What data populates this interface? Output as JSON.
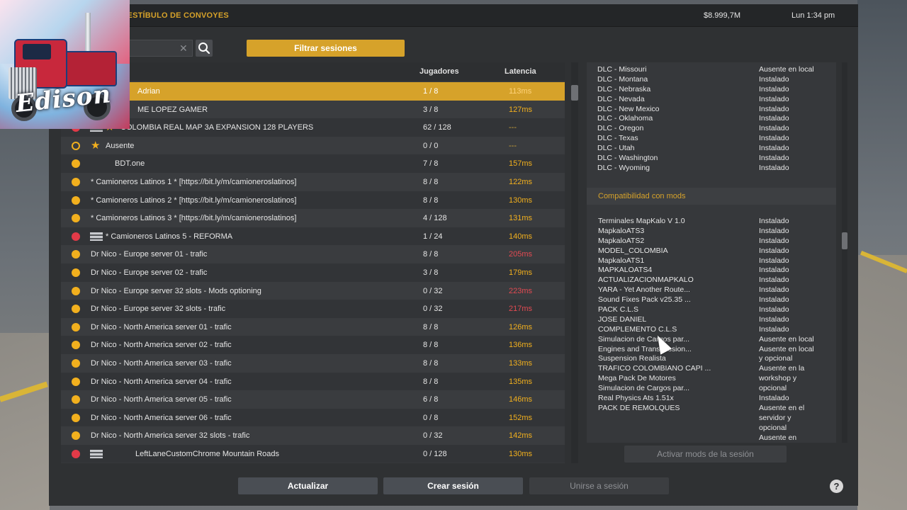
{
  "topbar": {
    "title": "VESTÍBULO DE CONVOYES",
    "money": "$8.999,7M",
    "time": "Lun 1:34 pm"
  },
  "logo": {
    "signature": "Edison"
  },
  "search": {
    "value": "",
    "placeholder": ""
  },
  "filter_button": "Filtrar sesiones",
  "list_header": {
    "players": "Jugadores",
    "latency": "Latencia"
  },
  "servers": [
    {
      "name": "Adrian",
      "players": "1 / 8",
      "latency": "113ms"
    },
    {
      "name": "ME LOPEZ GAMER",
      "players": "3 / 8",
      "latency": "127ms"
    },
    {
      "name": "COLOMBIA REAL MAP 3A EXPANSION 128 PLAYERS",
      "players": "62 / 128",
      "latency": "---"
    },
    {
      "name": "Ausente",
      "players": "0 / 0",
      "latency": "---"
    },
    {
      "name": "BDT.one",
      "players": "7 / 8",
      "latency": "157ms"
    },
    {
      "name": "* Camioneros Latinos 1 * [https://bit.ly/m/camioneroslatinos]",
      "players": "8 / 8",
      "latency": "122ms"
    },
    {
      "name": "* Camioneros Latinos 2 * [https://bit.ly/m/camioneroslatinos]",
      "players": "8 / 8",
      "latency": "130ms"
    },
    {
      "name": "* Camioneros Latinos 3 * [https://bit.ly/m/camioneroslatinos]",
      "players": "4 / 128",
      "latency": "131ms"
    },
    {
      "name": "* Camioneros Latinos 5 - REFORMA",
      "players": "1 / 24",
      "latency": "140ms"
    },
    {
      "name": "Dr Nico - Europe server 01 - trafic",
      "players": "8 / 8",
      "latency": "205ms"
    },
    {
      "name": "Dr Nico - Europe server 02 - trafic",
      "players": "3 / 8",
      "latency": "179ms"
    },
    {
      "name": "Dr Nico - Europe server 32 slots - Mods optioning",
      "players": "0 / 32",
      "latency": "223ms"
    },
    {
      "name": "Dr Nico - Europe server 32 slots - trafic",
      "players": "0 / 32",
      "latency": "217ms"
    },
    {
      "name": "Dr Nico - North America server 01 - trafic",
      "players": "8 / 8",
      "latency": "126ms"
    },
    {
      "name": "Dr Nico - North America server 02 - trafic",
      "players": "8 / 8",
      "latency": "136ms"
    },
    {
      "name": "Dr Nico - North America server 03 - trafic",
      "players": "8 / 8",
      "latency": "133ms"
    },
    {
      "name": "Dr Nico - North America server 04 - trafic",
      "players": "8 / 8",
      "latency": "135ms"
    },
    {
      "name": "Dr Nico - North America server 05 - trafic",
      "players": "6 / 8",
      "latency": "146ms"
    },
    {
      "name": "Dr Nico - North America server 06 - trafic",
      "players": "0 / 8",
      "latency": "152ms"
    },
    {
      "name": "Dr Nico - North America server 32 slots - trafic",
      "players": "0 / 32",
      "latency": "142ms"
    },
    {
      "name": "LeftLaneCustomChrome Mountain Roads",
      "players": "0 / 128",
      "latency": "130ms"
    }
  ],
  "dlc": [
    {
      "name": "DLC - Missouri",
      "status": "Ausente en local"
    },
    {
      "name": "DLC - Montana",
      "status": "Instalado"
    },
    {
      "name": "DLC - Nebraska",
      "status": "Instalado"
    },
    {
      "name": "DLC - Nevada",
      "status": "Instalado"
    },
    {
      "name": "DLC - New Mexico",
      "status": "Instalado"
    },
    {
      "name": "DLC - Oklahoma",
      "status": "Instalado"
    },
    {
      "name": "DLC - Oregon",
      "status": "Instalado"
    },
    {
      "name": "DLC - Texas",
      "status": "Instalado"
    },
    {
      "name": "DLC - Utah",
      "status": "Instalado"
    },
    {
      "name": "DLC - Washington",
      "status": "Instalado"
    },
    {
      "name": "DLC - Wyoming",
      "status": "Instalado"
    }
  ],
  "compat_title": "Compatibilidad con mods",
  "mods": [
    "Terminales MapKalo V 1.0",
    "MapkaloATS3",
    "MapkaloATS2",
    "MODEL_COLOMBIA",
    "MapkaloATS1",
    "MAPKALOATS4",
    "ACTUALIZACIONMAPKALO",
    "YARA - Yet Another Route...",
    "Sound Fixes Pack v25.35 ...",
    "PACK C.L.S",
    " JOSE DANIEL",
    "COMPLEMENTO C.L.S",
    "Simulacion de Cargos par...",
    "Engines and Transmission...",
    "Suspension Realista",
    "TRAFICO COLOMBIANO CAPI ...",
    "Mega Pack De Motores",
    "Simulacion de Cargos par...",
    "Real Physics Ats 1.51x",
    "PACK DE REMOLQUES"
  ],
  "mods_status_lines": [
    "Instalado",
    "Instalado",
    "Instalado",
    "Instalado",
    "Instalado",
    "Instalado",
    "Instalado",
    "Instalado",
    "Instalado",
    "Instalado",
    "Instalado",
    "Instalado",
    "Ausente en local",
    "Ausente en local",
    "y opcional",
    "Ausente en la",
    "workshop y",
    "opcional",
    "Instalado",
    "Ausente en el",
    "servidor y",
    "opcional",
    "Ausente en"
  ],
  "activate_button": "Activar mods de la sesión",
  "bottom_buttons": {
    "refresh": "Actualizar",
    "create": "Crear sesión",
    "join": "Unirse a sesión"
  },
  "help": "?"
}
